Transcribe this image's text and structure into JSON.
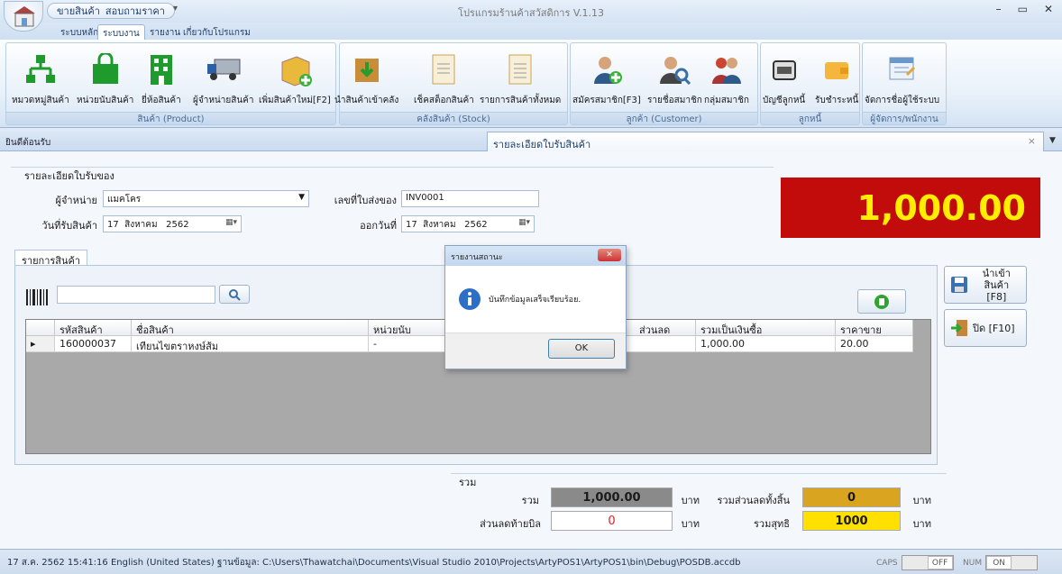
{
  "window": {
    "title": "โปรแกรมร้านค้าสวัสดิการ V.1.13",
    "qat_items": [
      "ขายสินค้า",
      "สอบถามราคา"
    ]
  },
  "ribbon_tabs": [
    "ระบบหลัก",
    "ระบบงาน",
    "รายงาน",
    "เกี่ยวกับโปรแกรม"
  ],
  "groups": [
    {
      "label": "สินค้า (Product)",
      "buttons": [
        "หมวดหมู่สินค้า",
        "หน่วยนับสินค้า",
        "ยี่ห้อสินค้า",
        "ผู้จำหน่ายสินค้า",
        "เพิ่มสินค้าใหม่[F2]"
      ]
    },
    {
      "label": "คลังสินค้า (Stock)",
      "buttons": [
        "นำสินค้าเข้าคลัง",
        "เช็คสต็อกสินค้า",
        "รายการสินค้าทั้งหมด"
      ]
    },
    {
      "label": "ลูกค้า (Customer)",
      "buttons": [
        "สมัครสมาชิก[F3]",
        "รายชื่อสมาชิก",
        "กลุ่มสมาชิก"
      ]
    },
    {
      "label": "ลูกหนี้",
      "buttons": [
        "บัญชีลูกหนี้",
        "รับชำระหนี้"
      ]
    },
    {
      "label": "ผู้จัดการ/พนักงาน",
      "buttons": [
        "จัดการชื่อผู้ใช้ระบบ"
      ]
    }
  ],
  "doc_tabs": {
    "left": "ยินดีต้อนรับ",
    "active": "รายละเอียดใบรับสินค้า"
  },
  "receipt": {
    "legend": "รายละเอียดใบรับของ",
    "supplier_label": "ผู้จำหน่าย",
    "supplier_value": "แมคโคร",
    "invoice_label": "เลขที่ใบส่งของ",
    "invoice_value": "INV0001",
    "recv_date_label": "วันที่รับสินค้า",
    "recv_date": {
      "day": "17",
      "month": "สิงหาคม",
      "year": "2562"
    },
    "issue_date_label": "ออกวันที่",
    "issue_date": {
      "day": "17",
      "month": "สิงหาคม",
      "year": "2562"
    }
  },
  "total_display": "1,000.00",
  "items": {
    "tab_label": "รายการสินค้า",
    "columns": [
      "รหัสสินค้า",
      "ชื่อสินค้า",
      "หน่วยนับ",
      "ส่วนลด",
      "รวมเป็นเงินซื้อ",
      "ราคาขาย"
    ],
    "rows": [
      [
        "160000037",
        "เทียนไขตราหงษ์ส้ม",
        "-",
        "",
        "1,000.00",
        "20.00"
      ]
    ]
  },
  "buttons": {
    "import": [
      "นำเข้าสินค้า",
      "[F8]"
    ],
    "close": "ปิด [F10]"
  },
  "summary": {
    "legend": "รวม",
    "total_label": "รวม",
    "total_value": "1,000.00",
    "unit": "บาท",
    "discount_all_label": "รวมส่วนลดทั้งสิ้น",
    "discount_all_value": "0",
    "bill_discount_label": "ส่วนลดท้ายบิล",
    "bill_discount_value": "0",
    "net_label": "รวมสุทธิ",
    "net_value": "1000"
  },
  "dialog": {
    "title": "รายงานสถานะ",
    "message": "บันทึกข้อมูลเสร็จเรียบร้อย.",
    "ok": "OK"
  },
  "status": {
    "text": "17 ส.ค. 2562 15:41:16 English (United States)  ฐานข้อมูล: C:\\Users\\Thawatchai\\Documents\\Visual Studio 2010\\Projects\\ArtyPOS1\\ArtyPOS1\\bin\\Debug\\POSDB.accdb",
    "caps_label": "CAPS",
    "caps_state": "OFF",
    "num_label": "NUM",
    "num_state": "ON"
  },
  "colors": {
    "total_bg": "#c20b0b",
    "total_fg": "#ffee00",
    "discount_bg": "#d9a520",
    "net_bg": "#ffe000"
  }
}
